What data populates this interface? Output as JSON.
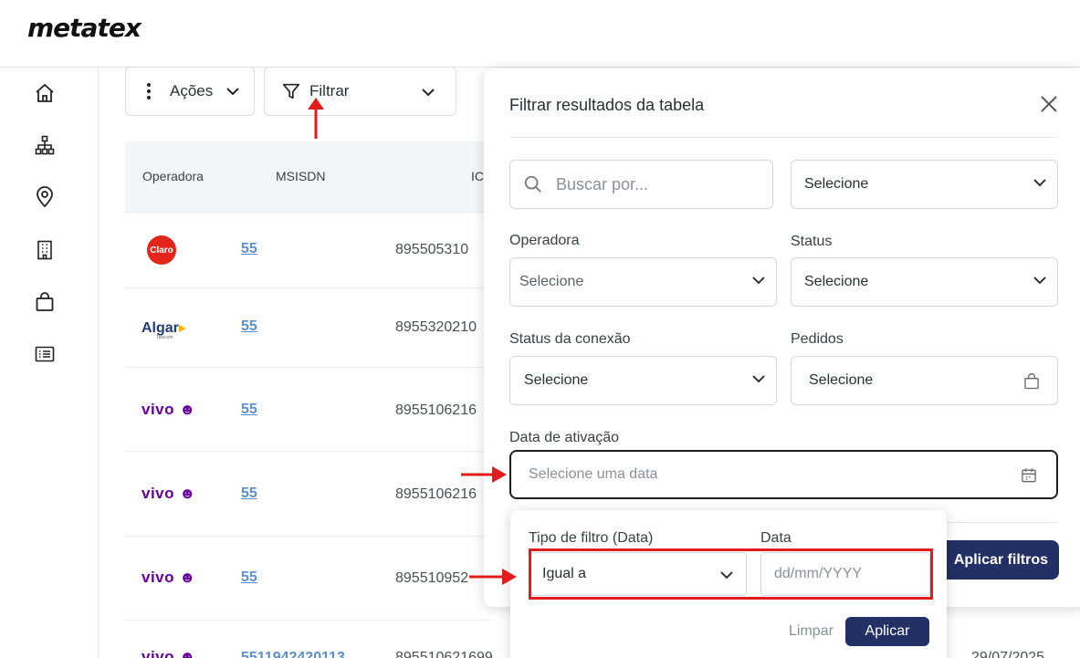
{
  "brand": {
    "logo_text": "metatex"
  },
  "sidebar": {
    "items": [
      {
        "name": "home",
        "icon": "home-icon"
      },
      {
        "name": "hierarchy",
        "icon": "sitemap-icon"
      },
      {
        "name": "location",
        "icon": "map-pin-icon"
      },
      {
        "name": "building",
        "icon": "building-icon"
      },
      {
        "name": "orders",
        "icon": "shopping-bag-icon"
      },
      {
        "name": "list",
        "icon": "list-icon"
      }
    ]
  },
  "toolbar": {
    "actions_label": "Ações",
    "filter_label": "Filtrar"
  },
  "table": {
    "headers": [
      "Operadora",
      "MSISDN",
      "IC"
    ],
    "rows": [
      {
        "operator": "Claro",
        "msisdn": "55",
        "iccid": "895505310"
      },
      {
        "operator": "Algar",
        "operator_sub": "Telecom",
        "msisdn": "55",
        "iccid": "8955320210"
      },
      {
        "operator": "vivo",
        "msisdn": "55",
        "iccid": "8955106216"
      },
      {
        "operator": "vivo",
        "msisdn": "55",
        "iccid": "8955106216"
      },
      {
        "operator": "vivo",
        "msisdn": "55",
        "iccid": "895510952"
      }
    ],
    "partial_row": {
      "msisdn": "5511942420113",
      "iccid": "895510621699",
      "date": "29/07/2025"
    }
  },
  "filter_panel": {
    "title": "Filtrar resultados da tabela",
    "search_placeholder": "Buscar por...",
    "search_scope_value": "Selecione",
    "operadora": {
      "label": "Operadora",
      "value": "Selecione"
    },
    "status": {
      "label": "Status",
      "value": "Selecione"
    },
    "status_conexao": {
      "label": "Status da conexão",
      "value": "Selecione"
    },
    "pedidos": {
      "label": "Pedidos",
      "value": "Selecione"
    },
    "data_ativacao": {
      "label": "Data de ativação",
      "placeholder": "Selecione uma data"
    },
    "apply_label": "Aplicar filtros"
  },
  "date_popover": {
    "filter_type_label": "Tipo de filtro (Data)",
    "filter_type_value": "Igual a",
    "date_label": "Data",
    "date_placeholder": "dd/mm/YYYY",
    "clear_label": "Limpar",
    "apply_label": "Aplicar"
  },
  "colors": {
    "primary": "#223066",
    "annotation_red": "#e01c1c",
    "link": "#5b8fc7",
    "vivo_purple": "#660099",
    "claro_red": "#e3251b"
  }
}
